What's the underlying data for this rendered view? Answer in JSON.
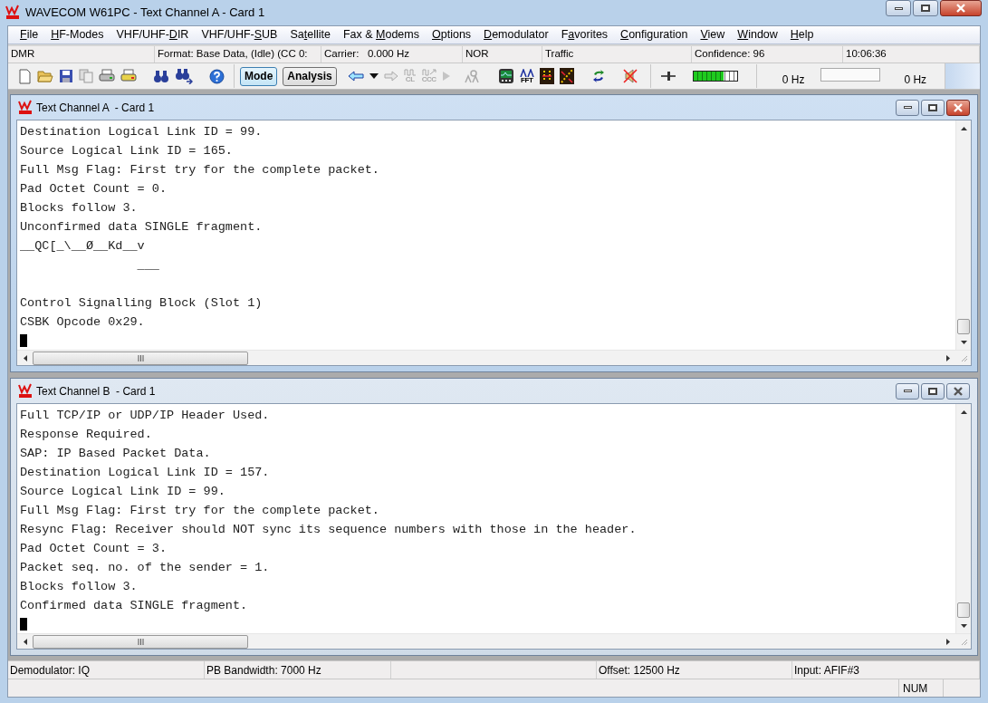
{
  "app_window": {
    "title": "WAVECOM W61PC - Text Channel A  - Card 1"
  },
  "menu": [
    {
      "key": "F",
      "post": "ile"
    },
    {
      "key": "H",
      "post": "F-Modes"
    },
    {
      "pre": "VHF/UHF-",
      "key": "D",
      "post": "IR"
    },
    {
      "pre": "VHF/UHF-",
      "key": "S",
      "post": "UB"
    },
    {
      "pre": "Sa",
      "key": "t",
      "post": "ellite"
    },
    {
      "pre": "Fax & ",
      "key": "M",
      "post": "odems"
    },
    {
      "key": "O",
      "post": "ptions"
    },
    {
      "key": "D",
      "post": "emodulator"
    },
    {
      "pre": "F",
      "key": "a",
      "post": "vorites"
    },
    {
      "key": "C",
      "post": "onfiguration"
    },
    {
      "key": "V",
      "post": "iew"
    },
    {
      "key": "W",
      "post": "indow"
    },
    {
      "key": "H",
      "post": "elp"
    }
  ],
  "info_bar": [
    "DMR",
    "Format: Base Data, (Idle) (CC 0:",
    "Carrier:   0.000 Hz",
    "NOR",
    "Traffic",
    "Confidence: 96",
    "10:06:36"
  ],
  "toolbar": {
    "buttons": [
      {
        "label": "Mode",
        "selected": true
      },
      {
        "label": "Analysis",
        "selected": false
      }
    ],
    "icon_captions": [
      {
        "text": "CL",
        "disabled": true
      },
      {
        "text": "CCC",
        "disabled": true
      },
      {
        "text": "FFT",
        "disabled": false
      }
    ],
    "signal_level": {
      "level": 0.7
    },
    "frequency_left": "0 Hz",
    "frequency_right": "0 Hz"
  },
  "child_windows": [
    {
      "title": "Text Channel A  - Card 1",
      "active": true,
      "lines": [
        "Destination Logical Link ID = 99.",
        "Source Logical Link ID = 165.",
        "Full Msg Flag: First try for the complete packet.",
        "Pad Octet Count = 0.",
        "Blocks follow 3.",
        "Unconfirmed data SINGLE fragment.",
        "__QC[_\\__Ø__Kd__v",
        "                ___",
        {
          "kind": "blank"
        },
        "Control Signalling Block (Slot 1)",
        "CSBK Opcode 0x29."
      ]
    },
    {
      "title": "Text Channel B  - Card 1",
      "active": false,
      "lines": [
        "Full TCP/IP or UDP/IP Header Used.",
        "Response Required.",
        "SAP: IP Based Packet Data.",
        "Destination Logical Link ID = 157.",
        "Source Logical Link ID = 99.",
        "Full Msg Flag: First try for the complete packet.",
        "Resync Flag: Receiver should NOT sync its sequence numbers with those in the header.",
        "Pad Octet Count = 3.",
        "Packet seq. no. of the sender = 1.",
        "Blocks follow 3.",
        "Confirmed data SINGLE fragment."
      ]
    }
  ],
  "status_bar": [
    "Demodulator: IQ",
    "PB Bandwidth: 7000 Hz",
    "Offset: 12500 Hz",
    "Input: AFIF#3"
  ],
  "status_indicator": "NUM"
}
